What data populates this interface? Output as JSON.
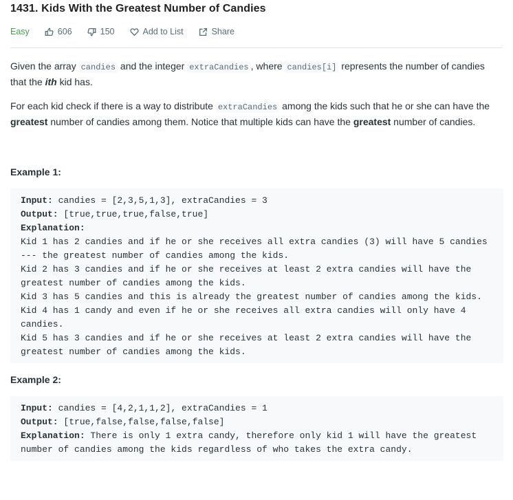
{
  "problem": {
    "title": "1431. Kids With the Greatest Number of Candies",
    "difficulty": "Easy",
    "likes": "606",
    "dislikes": "150",
    "add_to_list": "Add to List",
    "share": "Share"
  },
  "description": {
    "p1_a": "Given the array ",
    "p1_code1": "candies",
    "p1_b": " and the integer ",
    "p1_code2": "extraCandies",
    "p1_c": ", where ",
    "p1_code3": "candies[i]",
    "p1_d": " represents the number of candies that the ",
    "p1_em": "ith",
    "p1_e": " kid has.",
    "p2_a": "For each kid check if there is a way to distribute ",
    "p2_code": "extraCandies",
    "p2_b": " among the kids such that he or she can have the ",
    "p2_strong1": "greatest",
    "p2_c": " number of candies among them. Notice that multiple kids can have the ",
    "p2_strong2": "greatest",
    "p2_d": " number of candies."
  },
  "examples": [
    {
      "title": "Example 1:",
      "input_label": "Input:",
      "input": " candies = [2,3,5,1,3], extraCandies = 3",
      "output_label": "Output:",
      "output": " [true,true,true,false,true]",
      "explanation_label": "Explanation:",
      "explanation": "\nKid 1 has 2 candies and if he or she receives all extra candies (3) will have 5 candies --- the greatest number of candies among the kids.\nKid 2 has 3 candies and if he or she receives at least 2 extra candies will have the greatest number of candies among the kids.\nKid 3 has 5 candies and this is already the greatest number of candies among the kids.\nKid 4 has 1 candy and even if he or she receives all extra candies will only have 4 candies.\nKid 5 has 3 candies and if he or she receives at least 2 extra candies will have the greatest number of candies among the kids."
    },
    {
      "title": "Example 2:",
      "input_label": "Input:",
      "input": " candies = [4,2,1,1,2], extraCandies = 1",
      "output_label": "Output:",
      "output": " [true,false,false,false,false]",
      "explanation_label": "Explanation:",
      "explanation": " There is only 1 extra candy, therefore only kid 1 will have the greatest number of candies among the kids regardless of who takes the extra candy."
    }
  ],
  "icons": {
    "like": "thumbs-up-icon",
    "dislike": "thumbs-down-icon",
    "add": "heart-icon",
    "share": "share-icon"
  },
  "colors": {
    "easy": "#43a047",
    "text": "#263238",
    "muted": "#546e7a",
    "code_bg": "#f7f9fa"
  }
}
